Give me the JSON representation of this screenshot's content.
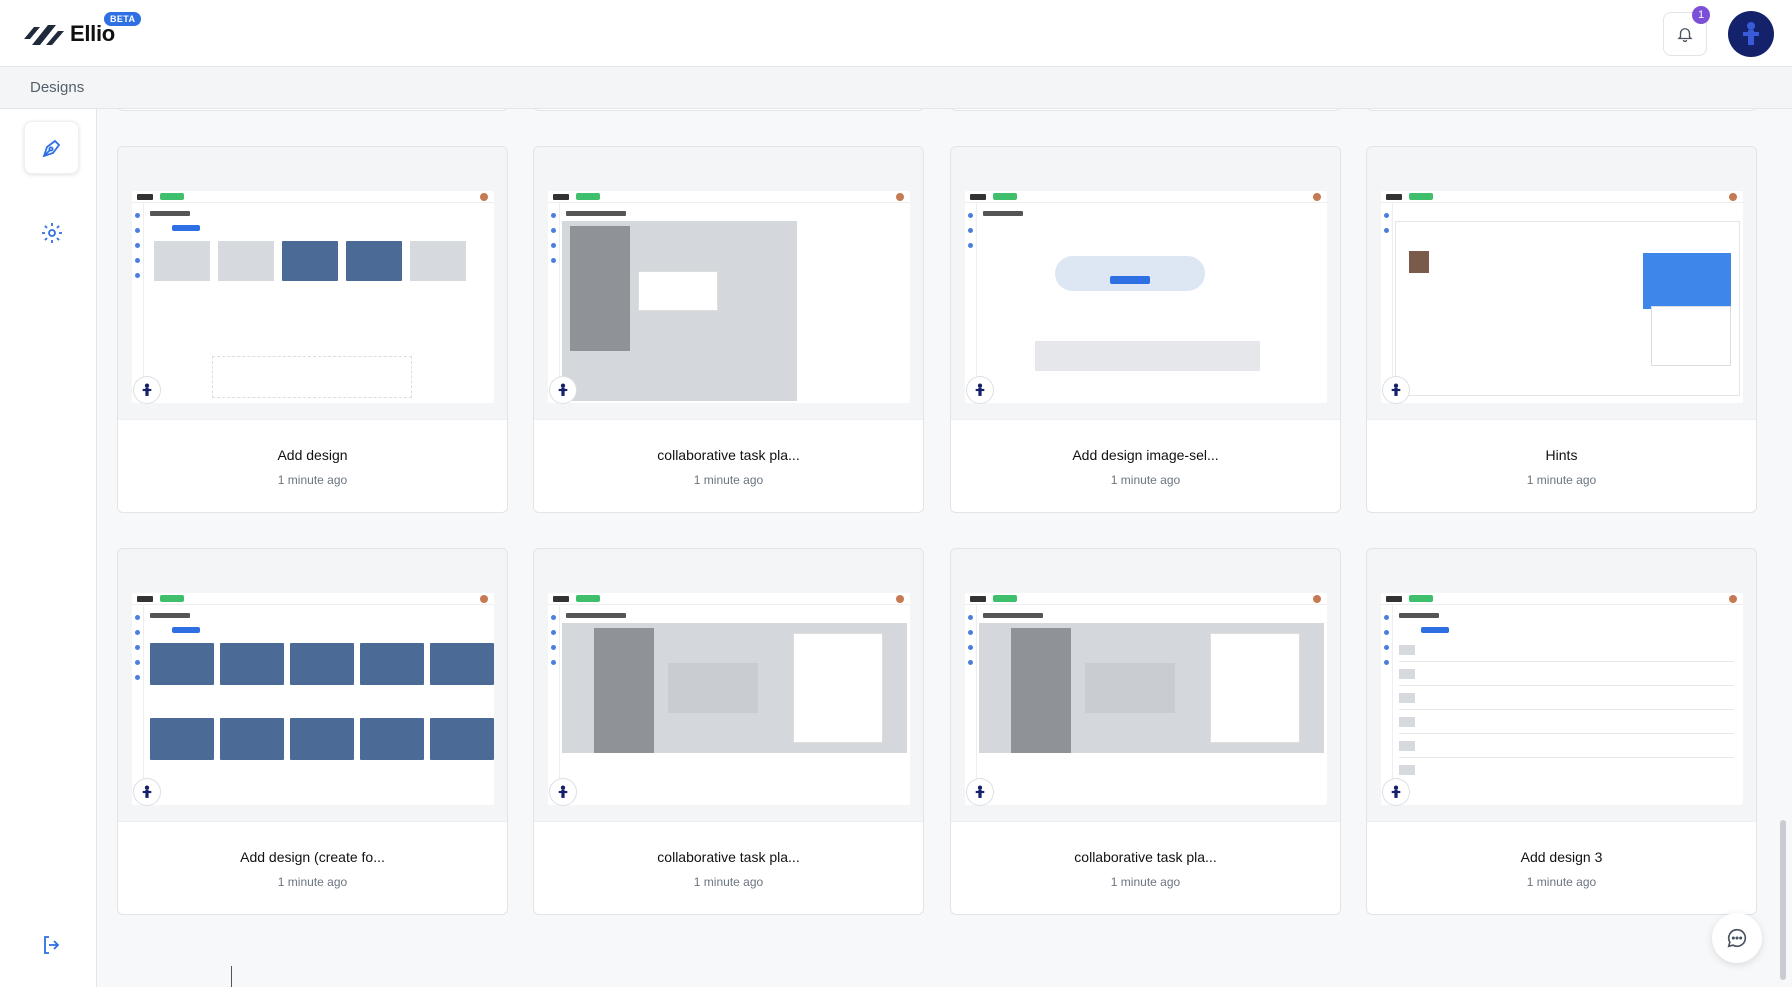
{
  "app": {
    "name": "Ellio",
    "badge": "BETA"
  },
  "header": {
    "notification_count": "1"
  },
  "breadcrumb": {
    "label": "Designs"
  },
  "sidebar": {
    "items": [
      {
        "icon": "pen-tool-icon",
        "active": true
      },
      {
        "icon": "gear-icon",
        "active": false
      }
    ],
    "logout_icon": "logout-icon"
  },
  "designs": [
    {
      "title": "Add design",
      "time": "1 minute ago",
      "preview": "grid"
    },
    {
      "title": "collaborative task pla...",
      "time": "1 minute ago",
      "preview": "dashboard"
    },
    {
      "title": "Add design image-sel...",
      "time": "1 minute ago",
      "preview": "empty"
    },
    {
      "title": "Hints",
      "time": "1 minute ago",
      "preview": "profile"
    },
    {
      "title": "Add design (create fo...",
      "time": "1 minute ago",
      "preview": "bluegrid"
    },
    {
      "title": "collaborative task pla...",
      "time": "1 minute ago",
      "preview": "dashboard"
    },
    {
      "title": "collaborative task pla...",
      "time": "1 minute ago",
      "preview": "dashboard"
    },
    {
      "title": "Add design 3",
      "time": "1 minute ago",
      "preview": "list"
    }
  ],
  "colors": {
    "accent": "#2f6fe4",
    "avatar": "#14216b",
    "badge": "#7b4fd6"
  }
}
